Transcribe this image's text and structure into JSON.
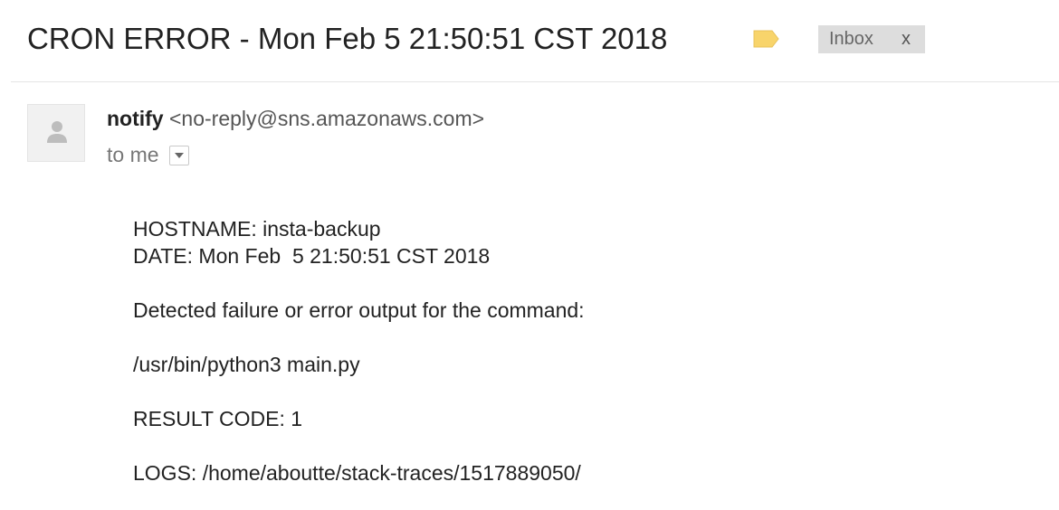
{
  "subject": "CRON ERROR - Mon Feb 5 21:50:51 CST 2018",
  "label": {
    "icon": "label-tag-icon",
    "color": "#F8D46B"
  },
  "inbox_chip": {
    "label": "Inbox",
    "close": "x"
  },
  "sender": {
    "name": "notify",
    "email": "<no-reply@sns.amazonaws.com>",
    "avatar_icon": "person-icon"
  },
  "recipient": {
    "text": "to me",
    "dropdown_icon": "chevron-down-icon"
  },
  "body": {
    "hostname": "HOSTNAME: insta-backup",
    "date": "DATE: Mon Feb  5 21:50:51 CST 2018",
    "detected": "Detected failure or error output for the command:",
    "command": "/usr/bin/python3 main.py",
    "result": "RESULT CODE: 1",
    "logs": "LOGS: /home/aboutte/stack-traces/1517889050/"
  }
}
